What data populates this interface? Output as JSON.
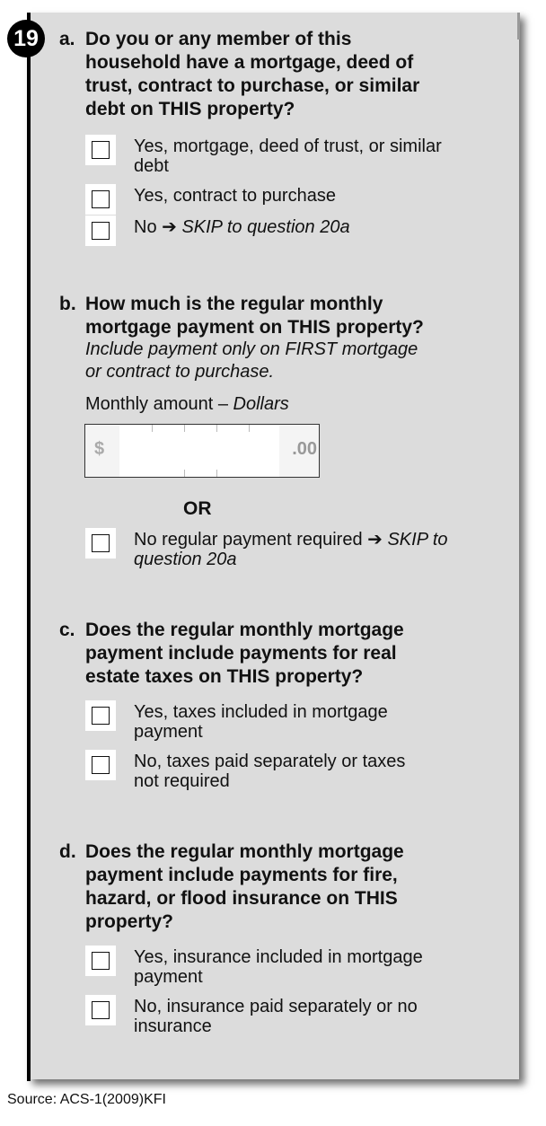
{
  "question_number": "19",
  "a": {
    "letter": "a.",
    "lines": [
      "Do you or any member of this",
      "household have a mortgage, deed of",
      "trust, contract to purchase, or similar",
      "debt on THIS property?"
    ],
    "options": [
      {
        "text": "Yes, mortgage, deed of trust, or similar",
        "text2": "debt"
      },
      {
        "text": "Yes, contract to purchase"
      },
      {
        "text": "No ➔ ",
        "skip": "SKIP to question 20a"
      }
    ]
  },
  "b": {
    "letter": "b.",
    "lines": [
      "How much is the regular monthly",
      "mortgage payment on THIS property?"
    ],
    "hint_lines": [
      "Include payment only on FIRST mortgage",
      "or contract to purchase."
    ],
    "amount_label": "Monthly amount – ",
    "amount_unit": "Dollars",
    "dollar_sign": "$",
    "cents": ".00",
    "or": "OR",
    "option": {
      "text": "No regular payment required ➔ ",
      "skip": "SKIP to",
      "skip2": "question 20a"
    }
  },
  "c": {
    "letter": "c.",
    "lines": [
      "Does the regular monthly mortgage",
      "payment include payments for real",
      "estate taxes on THIS property?"
    ],
    "options": [
      {
        "text": "Yes, taxes included in mortgage",
        "text2": "payment"
      },
      {
        "text": "No, taxes paid separately or taxes",
        "text2": "not required"
      }
    ]
  },
  "d": {
    "letter": "d.",
    "lines": [
      "Does the regular monthly mortgage",
      "payment include payments for fire,",
      "hazard, or flood insurance on THIS",
      "property?"
    ],
    "options": [
      {
        "text": "Yes, insurance included in mortgage",
        "text2": "payment"
      },
      {
        "text": "No, insurance paid separately or no",
        "text2": "insurance"
      }
    ]
  },
  "source": "Source:  ACS-1(2009)KFI"
}
